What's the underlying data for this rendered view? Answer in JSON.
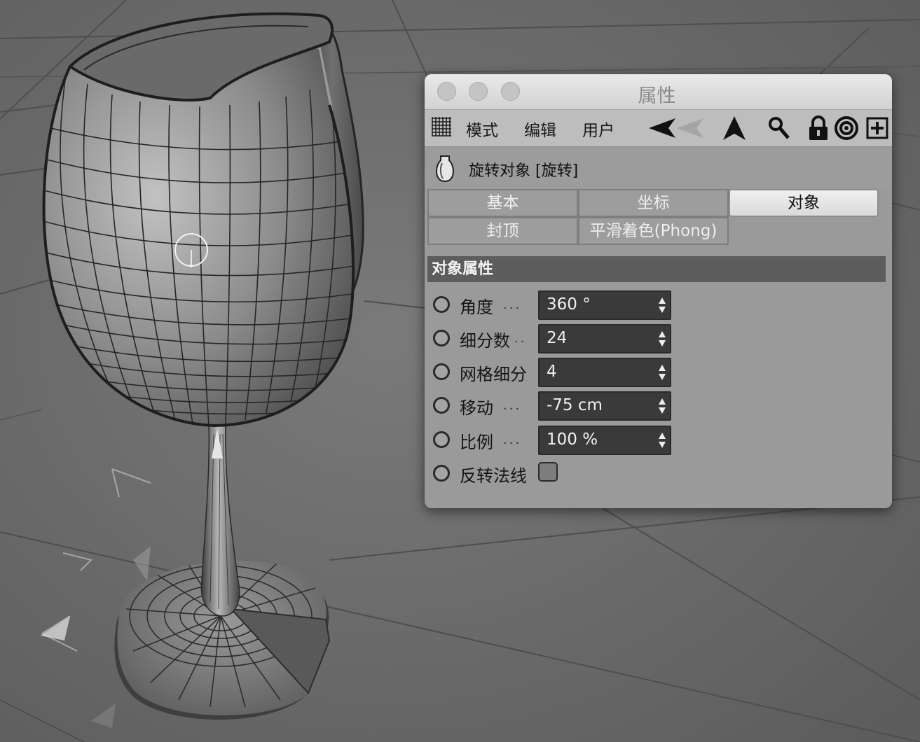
{
  "window": {
    "title": "属性"
  },
  "menu": {
    "items": [
      "模式",
      "编辑",
      "用户"
    ]
  },
  "object": {
    "title": "旋转对象 [旋转]",
    "icon": "lathe-object-icon"
  },
  "tabs": {
    "row1": [
      "基本",
      "坐标",
      "对象"
    ],
    "row2": [
      "封顶",
      "平滑着色(Phong)"
    ],
    "active": "对象"
  },
  "section": {
    "title": "对象属性"
  },
  "properties": [
    {
      "label": "角度",
      "dots": "...",
      "value": "360 °"
    },
    {
      "label": "细分数",
      "dots": "..",
      "value": "24"
    },
    {
      "label": "网格细分",
      "dots": "",
      "value": "4"
    },
    {
      "label": "移动",
      "dots": "...",
      "value": "-75 cm"
    },
    {
      "label": "比例",
      "dots": "...",
      "value": "100 %"
    },
    {
      "label": "反转法线",
      "checked": false
    }
  ],
  "toolbar_icons": [
    "back-arrow-icon",
    "up-arrow-icon",
    "search-icon",
    "lock-icon",
    "target-icon",
    "new-panel-icon"
  ]
}
